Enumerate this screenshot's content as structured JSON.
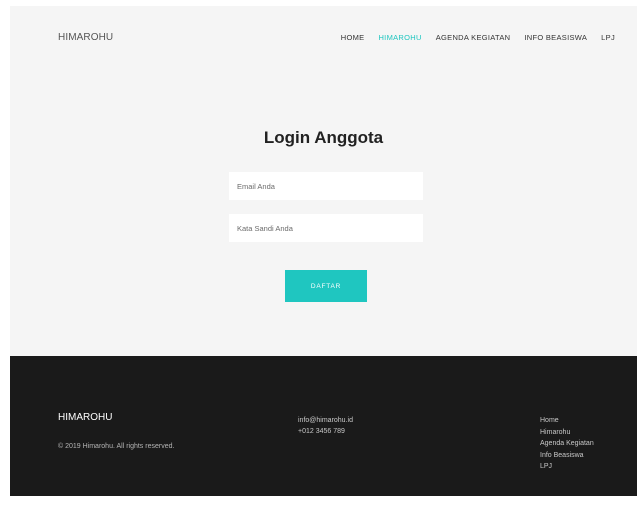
{
  "header": {
    "brand": "HIMAROHU",
    "nav": [
      {
        "label": "HOME",
        "active": false
      },
      {
        "label": "HIMAROHU",
        "active": true
      },
      {
        "label": "AGENDA KEGIATAN",
        "active": false
      },
      {
        "label": "INFO BEASISWA",
        "active": false
      },
      {
        "label": "LPJ",
        "active": false
      }
    ]
  },
  "login": {
    "title": "Login Anggota",
    "email_placeholder": "Email Anda",
    "email_value": "",
    "password_placeholder": "Kata Sandi Anda",
    "password_value": "",
    "submit_label": "DAFTAR"
  },
  "footer": {
    "brand": "HIMAROHU",
    "copyright": "© 2019 Himarohu. All rights reserved.",
    "email": "info@himarohu.id",
    "phone": "+012 3456 789",
    "links": [
      "Home",
      "Himarohu",
      "Agenda Kegiatan",
      "Info Beasiswa",
      "LPJ"
    ]
  },
  "colors": {
    "accent": "#1fc6c0",
    "footer_bg": "#1a1a1a",
    "page_bg": "#f5f5f5"
  }
}
